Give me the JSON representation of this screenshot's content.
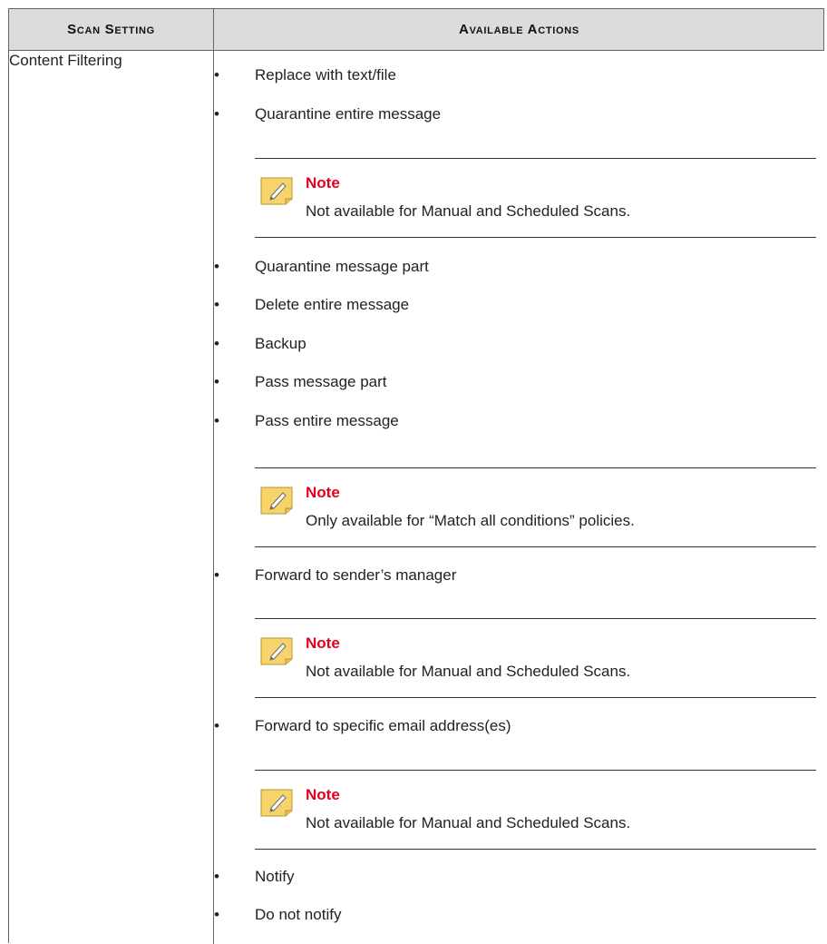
{
  "header": {
    "col1": "Scan Setting",
    "col2": "Available Actions"
  },
  "row": {
    "setting": "Content Filtering",
    "bullet_glyph": "•",
    "actions": [
      "Replace with text/file",
      "Quarantine entire message",
      "Quarantine message part",
      "Delete entire message",
      "Backup",
      "Pass message part",
      "Pass entire message",
      "Forward to sender’s manager",
      "Forward to specific email address(es)",
      "Notify",
      "Do not notify"
    ],
    "notes": [
      {
        "label": "Note",
        "text": "Not available for Manual and Scheduled Scans."
      },
      {
        "label": "Note",
        "text": "Only available for “Match all conditions” policies."
      },
      {
        "label": "Note",
        "text": "Not available for Manual and Scheduled Scans."
      },
      {
        "label": "Note",
        "text": "Not available for Manual and Scheduled Scans."
      }
    ]
  },
  "colors": {
    "header_bg": "#dcdcdc",
    "note_label": "#e3001b",
    "note_icon_fill": "#f6d46a"
  },
  "icons": {
    "note": "note-pencil-icon"
  }
}
